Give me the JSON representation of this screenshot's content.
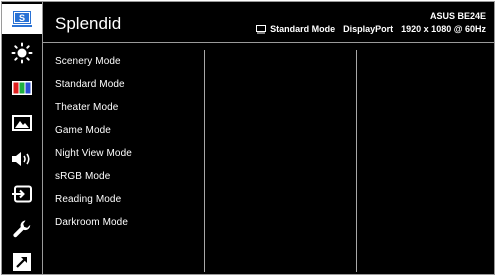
{
  "header": {
    "title": "Splendid",
    "model": "ASUS BE24E",
    "mode": "Standard Mode",
    "input": "DisplayPort",
    "resolution": "1920 x 1080 @ 60Hz"
  },
  "sidebar": {
    "items": [
      {
        "icon": "splendid-icon",
        "active": true
      },
      {
        "icon": "brightness-icon",
        "active": false
      },
      {
        "icon": "color-icon",
        "active": false
      },
      {
        "icon": "image-icon",
        "active": false
      },
      {
        "icon": "sound-icon",
        "active": false
      },
      {
        "icon": "input-select-icon",
        "active": false
      },
      {
        "icon": "system-setup-icon",
        "active": false
      },
      {
        "icon": "shortcut-icon",
        "active": false
      }
    ]
  },
  "menu": {
    "items": [
      "Scenery Mode",
      "Standard Mode",
      "Theater Mode",
      "Game Mode",
      "Night View Mode",
      "sRGB Mode",
      "Reading Mode",
      "Darkroom Mode"
    ]
  },
  "colors": {
    "background": "#000000",
    "text": "#ffffff",
    "accent": "#2a72d5",
    "divider": "#9a9a9a"
  }
}
